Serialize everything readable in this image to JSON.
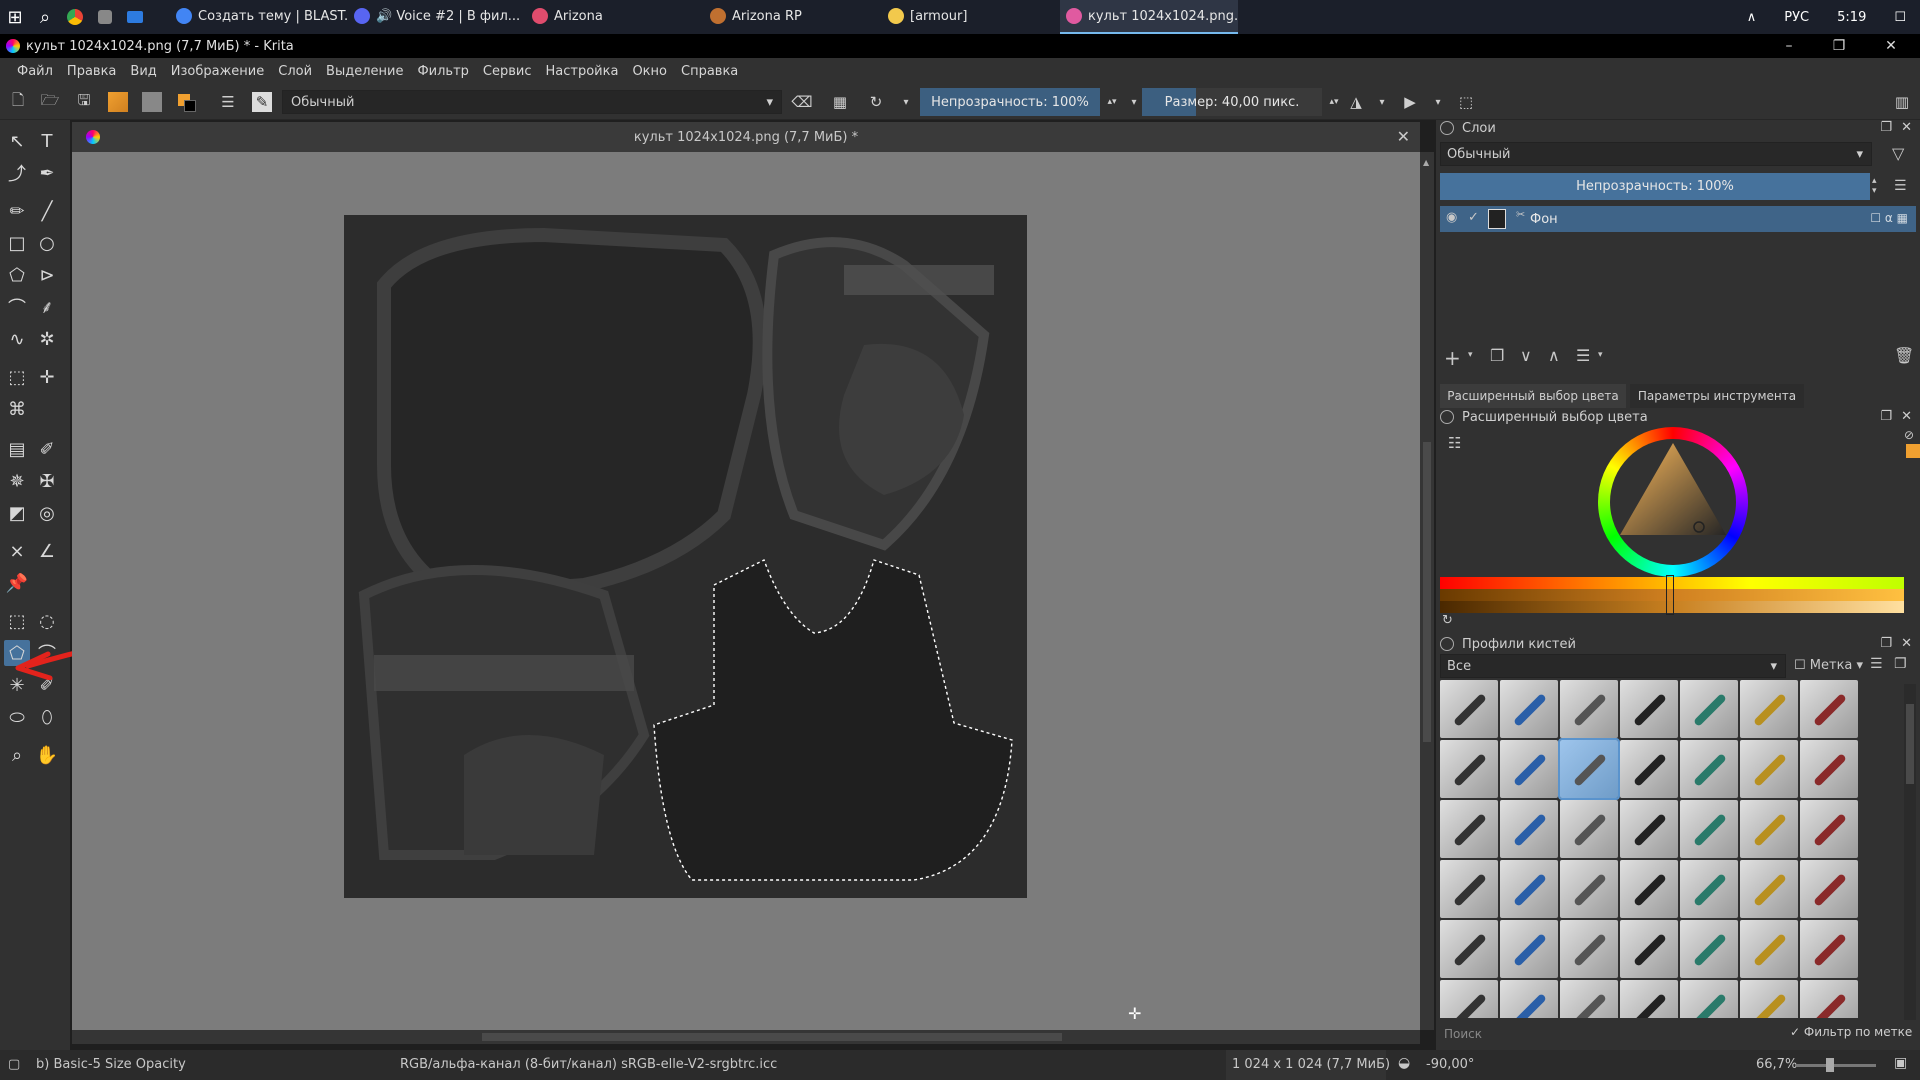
{
  "taskbar": {
    "tasks": [
      {
        "label": "Создать тему | BLAST...",
        "color": "#4285f4"
      },
      {
        "label": "🔊 Voice #2 | В фил...",
        "color": "#5865f2"
      },
      {
        "label": "Arizona",
        "color": "#e04c6d"
      },
      {
        "label": "Arizona RP",
        "color": "#c07030"
      },
      {
        "label": "[armour]",
        "color": "#f2c94c"
      },
      {
        "label": "культ 1024x1024.png...",
        "color": "#e05aa0"
      }
    ],
    "lang": "РУС",
    "time": "5:19"
  },
  "window": {
    "title": "культ 1024x1024.png (7,7 МиБ) * - Krita"
  },
  "menu": [
    "Файл",
    "Правка",
    "Вид",
    "Изображение",
    "Слой",
    "Выделение",
    "Фильтр",
    "Сервис",
    "Настройка",
    "Окно",
    "Справка"
  ],
  "toolbar": {
    "blend_mode": "Обычный",
    "opacity": "Непрозрачность: 100%",
    "opacity_level": 1.0,
    "size": "Размер: 40,00 пикс."
  },
  "document": {
    "tab_title": "культ 1024x1024.png (7,7 МиБ) *"
  },
  "layers": {
    "title": "Слои",
    "blend_mode": "Обычный",
    "opacity": "Непрозрачность:  100%",
    "items": [
      {
        "name": "Фон"
      }
    ]
  },
  "color_panel": {
    "tabs": [
      "Расширенный выбор цвета",
      "Параметры инструмента"
    ],
    "title": "Расширенный выбор цвета",
    "fg_color": "#f0a030"
  },
  "brushes": {
    "title": "Профили кистей",
    "filter": "Все",
    "tag_label": "Метка",
    "search_placeholder": "Поиск",
    "filter_by_tag": "Фильтр по метке",
    "count": 42,
    "selected_index": 9
  },
  "status": {
    "preset": "b) Basic-5 Size Opacity",
    "color_space": "RGB/альфа-канал (8-бит/канал)  sRGB-elle-V2-srgbtrc.icc",
    "dimensions": "1 024 x 1 024 (7,7 МиБ)",
    "rotation": "-90,00°",
    "zoom": "66,7%"
  },
  "accent": "#46729c"
}
